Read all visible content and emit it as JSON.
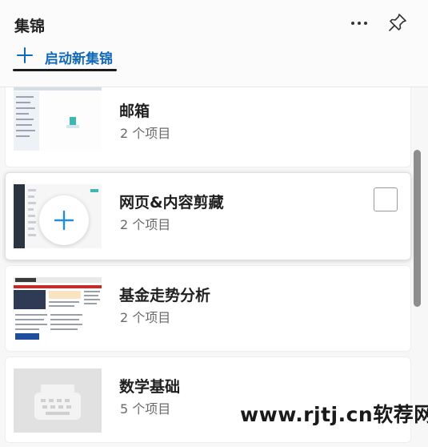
{
  "header": {
    "title": "集锦",
    "more_icon": "more-horizontal-icon",
    "pin_icon": "pin-icon",
    "new_collection_label": "启动新集锦"
  },
  "collections": [
    {
      "title": "邮箱",
      "count": "2 个项目",
      "thumbnail": "mail-webpage-thumbnail"
    },
    {
      "title": "网页&内容剪藏",
      "count": "2 个项目",
      "thumbnail": "add-to-collection-thumbnail",
      "selected": true
    },
    {
      "title": "基金走势分析",
      "count": "2 个项目",
      "thumbnail": "fund-webpage-thumbnail"
    },
    {
      "title": "数学基础",
      "count": "5 个项目",
      "thumbnail": "typewriter-placeholder-icon"
    }
  ],
  "watermark": "www.rjtj.cn软荐网",
  "colors": {
    "accent": "#1169b8",
    "scrollbar": "#8d8d8d"
  }
}
